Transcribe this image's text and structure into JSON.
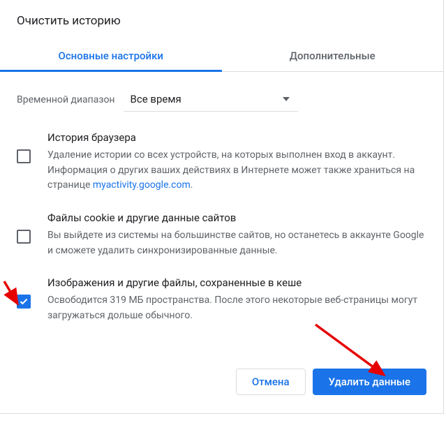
{
  "dialog": {
    "title": "Очистить историю"
  },
  "tabs": {
    "basic": "Основные настройки",
    "advanced": "Дополнительные"
  },
  "range": {
    "label": "Временной диапазон",
    "value": "Все время"
  },
  "items": [
    {
      "checked": false,
      "title": "История браузера",
      "desc_before": "Удаление истории со всех устройств, на которых выполнен вход в аккаунт. Информация о других ваших действиях в Интернете может также храниться на странице ",
      "link_text": "myactivity.google.com",
      "desc_after": "."
    },
    {
      "checked": false,
      "title": "Файлы cookie и другие данные сайтов",
      "desc_before": "Вы выйдете из системы на большинстве сайтов, но останетесь в аккаунте Google и сможете удалить синхронизированные данные.",
      "link_text": "",
      "desc_after": ""
    },
    {
      "checked": true,
      "title": "Изображения и другие файлы, сохраненные в кеше",
      "desc_before": "Освободится 319 МБ пространства. После этого некоторые веб-страницы могут загружаться дольше обычного.",
      "link_text": "",
      "desc_after": ""
    }
  ],
  "buttons": {
    "cancel": "Отмена",
    "clear": "Удалить данные"
  }
}
